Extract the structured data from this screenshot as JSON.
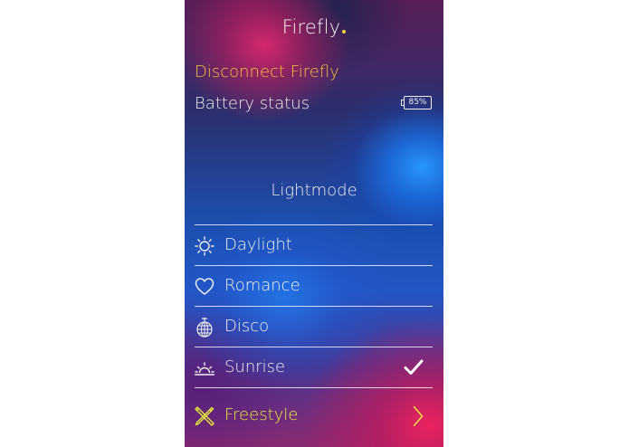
{
  "app": {
    "title": "Firefly",
    "title_dot_color": "#f0d23c"
  },
  "connection": {
    "disconnect_label": "Disconnect Firefly",
    "disconnect_color": "#f3c53a"
  },
  "battery": {
    "label": "Battery status",
    "level_text": "85%"
  },
  "lightmode": {
    "title": "Lightmode",
    "items": [
      {
        "label": "Daylight",
        "icon": "sun-icon",
        "selected": false
      },
      {
        "label": "Romance",
        "icon": "heart-icon",
        "selected": false
      },
      {
        "label": "Disco",
        "icon": "disco-ball-icon",
        "selected": false
      },
      {
        "label": "Sunrise",
        "icon": "sunrise-icon",
        "selected": true
      }
    ],
    "freestyle": {
      "label": "Freestyle",
      "icon": "brush-pencil-icon",
      "accent_color": "#e7eb3a"
    }
  }
}
